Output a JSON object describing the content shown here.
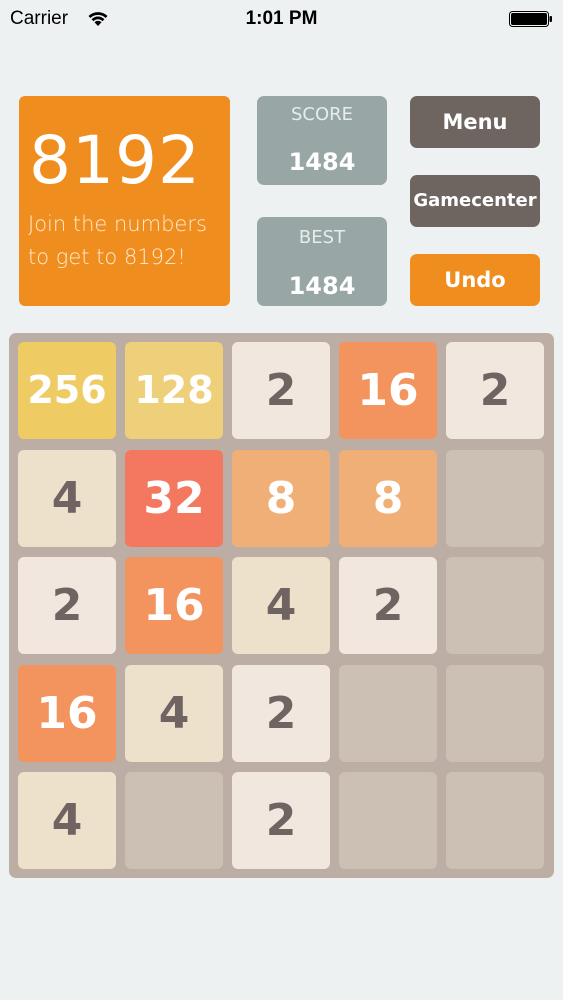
{
  "status_bar": {
    "carrier": "Carrier",
    "time": "1:01 PM",
    "wifi_icon": "wifi-icon",
    "battery_icon": "battery-icon"
  },
  "title_tile": {
    "number": "8192",
    "tagline": "Join the numbers\nto get to 8192!"
  },
  "score": {
    "label": "SCORE",
    "value": "1484"
  },
  "best": {
    "label": "BEST",
    "value": "1484"
  },
  "buttons": {
    "menu": "Menu",
    "gamecenter": "Gamecenter",
    "undo": "Undo"
  },
  "colors": {
    "accent_orange": "#ef8d1e",
    "button_dark": "#6f6560",
    "score_box": "#98a7a5",
    "board": "#bcaea4",
    "empty_cell": "#ccc0b4"
  },
  "board": {
    "rows": [
      [
        "256",
        "128",
        "2",
        "16",
        "2"
      ],
      [
        "4",
        "32",
        "8",
        "8",
        ""
      ],
      [
        "2",
        "16",
        "4",
        "2",
        ""
      ],
      [
        "16",
        "4",
        "2",
        "",
        ""
      ],
      [
        "4",
        "",
        "2",
        "",
        ""
      ]
    ]
  }
}
